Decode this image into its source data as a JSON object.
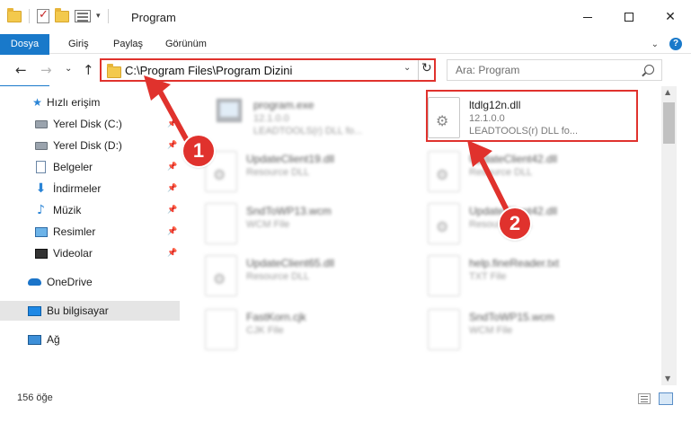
{
  "window": {
    "title": "Program",
    "minimize_glyph": "—",
    "maximize_glyph": "☐",
    "close_glyph": "✕"
  },
  "ribbon": {
    "tabs": [
      {
        "label": "Dosya"
      },
      {
        "label": "Giriş"
      },
      {
        "label": "Paylaş"
      },
      {
        "label": "Görünüm"
      }
    ],
    "file_tab_color": "#1979ca",
    "help": "?"
  },
  "navigation": {
    "back_glyph": "←",
    "forward_glyph": "→",
    "recent_glyph": "⌄",
    "up_glyph": "↑",
    "address": "C:\\Program Files\\Program Dizini",
    "refresh_glyph": "↻",
    "search_placeholder": "Ara: Program"
  },
  "sidebar": {
    "items": [
      {
        "label": "Hızlı erişim",
        "icon": "star-icon"
      },
      {
        "label": "Yerel Disk (C:)",
        "icon": "drive-icon",
        "pinned": true
      },
      {
        "label": "Yerel Disk (D:)",
        "icon": "drive-icon",
        "pinned": true
      },
      {
        "label": "Belgeler",
        "icon": "documents-icon",
        "pinned": true
      },
      {
        "label": "İndirmeler",
        "icon": "downloads-icon",
        "pinned": true
      },
      {
        "label": "Müzik",
        "icon": "music-icon",
        "pinned": true
      },
      {
        "label": "Resimler",
        "icon": "pictures-icon",
        "pinned": true
      },
      {
        "label": "Videolar",
        "icon": "videos-icon",
        "pinned": true
      },
      {
        "label": "OneDrive",
        "icon": "onedrive-icon"
      },
      {
        "label": "Bu bilgisayar",
        "icon": "this-pc-icon",
        "selected": true
      },
      {
        "label": "Ağ",
        "icon": "network-icon"
      }
    ]
  },
  "files": [
    {
      "name": "program.exe",
      "line2": "12.1.0.0",
      "line3": "LEADTOOLS(r) DLL fo...",
      "icon": "exe-icon",
      "blurred": true
    },
    {
      "name": "ltdlg12n.dll",
      "line2": "12.1.0.0",
      "line3": "LEADTOOLS(r) DLL fo...",
      "icon": "dll-icon",
      "blurred": false,
      "highlighted": true
    },
    {
      "name": "UpdateClient19.dll",
      "line2": "Resource DLL",
      "icon": "dll-icon",
      "blurred": true
    },
    {
      "name": "UpdateClient42.dll",
      "line2": "Resource DLL",
      "icon": "dll-icon",
      "blurred": true
    },
    {
      "name": "SndToWP13.wcm",
      "line2": "WCM File",
      "icon": "file-icon",
      "blurred": true
    },
    {
      "name": "UpdateClient42.dll",
      "line2": "Resource DLL",
      "icon": "dll-icon",
      "blurred": true
    },
    {
      "name": "UpdateClient65.dll",
      "line2": "Resource DLL",
      "icon": "dll-icon",
      "blurred": true
    },
    {
      "name": "help.fineReader.txt",
      "line2": "TXT File",
      "icon": "file-icon",
      "blurred": true
    },
    {
      "name": "FastKorn.cjk",
      "line2": "CJK File",
      "icon": "file-icon",
      "blurred": true
    },
    {
      "name": "SndToWP15.wcm",
      "line2": "WCM File",
      "icon": "file-icon",
      "blurred": true
    }
  ],
  "status": {
    "item_count": "156 öğe"
  },
  "annotations": [
    {
      "label": "1"
    },
    {
      "label": "2"
    }
  ],
  "colors": {
    "annotation_red": "#e0322d",
    "accent_blue": "#1979ca"
  }
}
